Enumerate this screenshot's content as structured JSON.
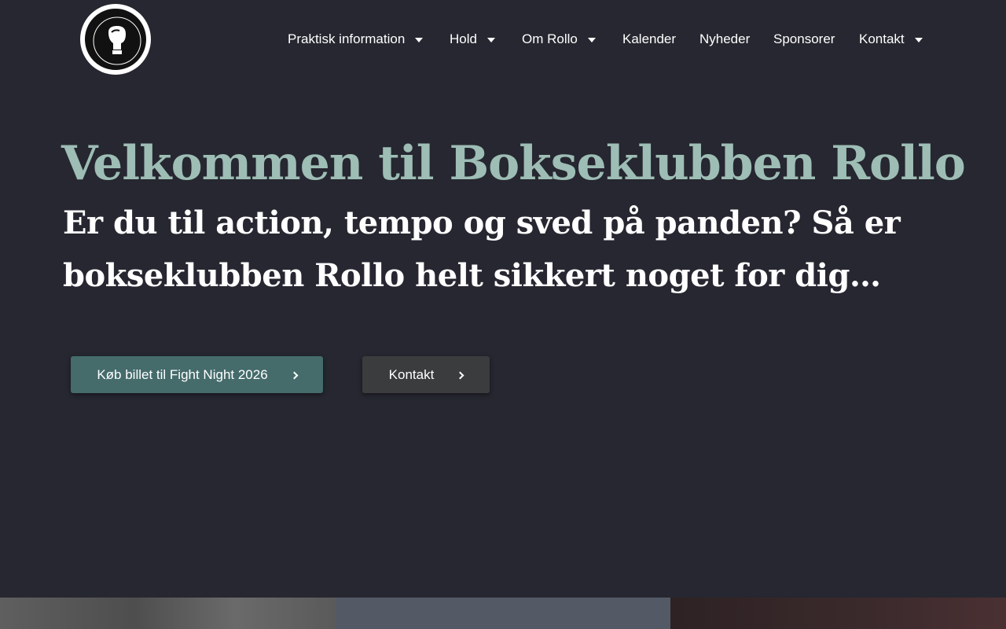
{
  "header": {
    "logo_alt": "Bokseklubben Rollo Svendborg 1923",
    "nav": [
      {
        "label": "Praktisk information",
        "has_dropdown": true
      },
      {
        "label": "Hold",
        "has_dropdown": true
      },
      {
        "label": "Om Rollo",
        "has_dropdown": true
      },
      {
        "label": "Kalender",
        "has_dropdown": false
      },
      {
        "label": "Nyheder",
        "has_dropdown": false
      },
      {
        "label": "Sponsorer",
        "has_dropdown": false
      },
      {
        "label": "Kontakt",
        "has_dropdown": true
      }
    ]
  },
  "hero": {
    "title": "Velkommen til Bokseklubben Rollo",
    "subtitle": "Er du til action, tempo og sved på panden? Så er bokseklubben Rollo helt sikkert noget for dig…",
    "buttons": {
      "primary": "Køb billet til Fight Night 2026",
      "secondary": "Kontakt"
    }
  },
  "colors": {
    "background": "#262730",
    "title": "#9dbdb5",
    "primary_button": "#456b6b",
    "secondary_button": "#3a3c3e"
  }
}
